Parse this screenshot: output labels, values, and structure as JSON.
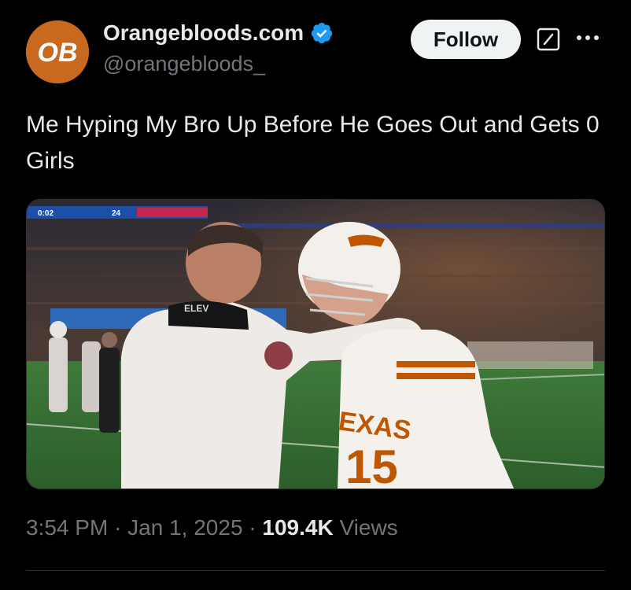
{
  "author": {
    "display_name": "Orangebloods.com",
    "handle": "@orangebloods_",
    "avatar_text": "OB",
    "avatar_color": "#c8691f",
    "verified": true,
    "verified_color": "#1d9bf0"
  },
  "actions": {
    "follow_label": "Follow",
    "grok_icon": "grok-icon",
    "more_icon": "more-icon"
  },
  "tweet": {
    "text": "Me Hyping My Bro Up Before He Goes Out and Gets 0 Girls"
  },
  "media": {
    "scoreboard_text": "0:02",
    "scoreboard_number": "24",
    "headset_text": "ELEV",
    "jersey_text": "EXAS",
    "jersey_number": "15"
  },
  "meta": {
    "time": "3:54 PM",
    "separator": "·",
    "date": "Jan 1, 2025",
    "views_count": "109.4K",
    "views_label": "Views"
  },
  "colors": {
    "background": "#000000",
    "text_primary": "#e7e9ea",
    "text_secondary": "#71767b",
    "button_bg": "#eff3f4",
    "texas_orange": "#bf5700"
  }
}
